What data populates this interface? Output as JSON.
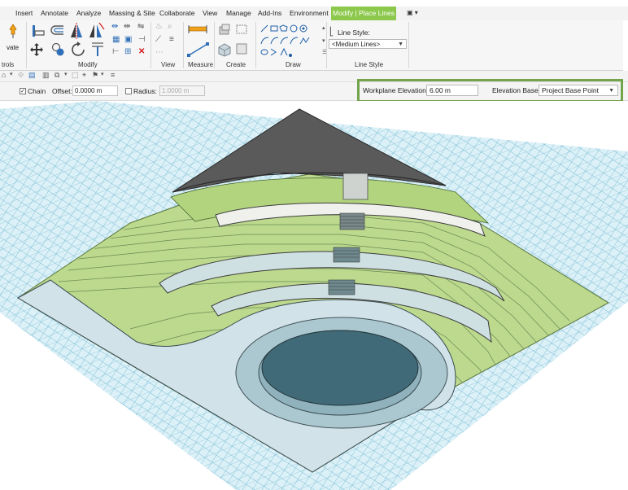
{
  "tabs": [
    {
      "label": "Insert",
      "active": false
    },
    {
      "label": "Annotate",
      "active": false
    },
    {
      "label": "Analyze",
      "active": false
    },
    {
      "label": "Massing & Site",
      "active": false
    },
    {
      "label": "Collaborate",
      "active": false
    },
    {
      "label": "View",
      "active": false
    },
    {
      "label": "Manage",
      "active": false
    },
    {
      "label": "Add-Ins",
      "active": false
    },
    {
      "label": "Environment",
      "active": false
    },
    {
      "label": "Modify | Place Lines",
      "active": true
    }
  ],
  "tab_extra": "▣ ▾",
  "ribbon": {
    "activate_label": "vate",
    "panels": {
      "controls": "trols",
      "modify": "Modify",
      "view": "View",
      "measure": "Measure",
      "create": "Create",
      "draw": "Draw",
      "line_style": "Line Style"
    },
    "line_style_label": "Line Style:",
    "line_style_value": "<Medium Lines>"
  },
  "options_bar": {
    "chain_label": "Chain",
    "chain_checked": true,
    "offset_label": "Offset:",
    "offset_value": "0.0000 m",
    "radius_label": "Radius:",
    "radius_checked": false,
    "radius_value": "1.0000 m",
    "workplane_elevation_label": "Workplane Elevation",
    "workplane_elevation_value": "6.00 m",
    "elevation_base_label": "Elevation Base",
    "elevation_base_value": "Project Base Point"
  },
  "colors": {
    "active_tab": "#8cc84b",
    "highlight_border": "#73a34b",
    "grid": "#5fb2cc",
    "terrain": "#b9d889",
    "roof": "#5a5a5a",
    "plaza": "#d1e3e8",
    "pond": "#416a78"
  }
}
